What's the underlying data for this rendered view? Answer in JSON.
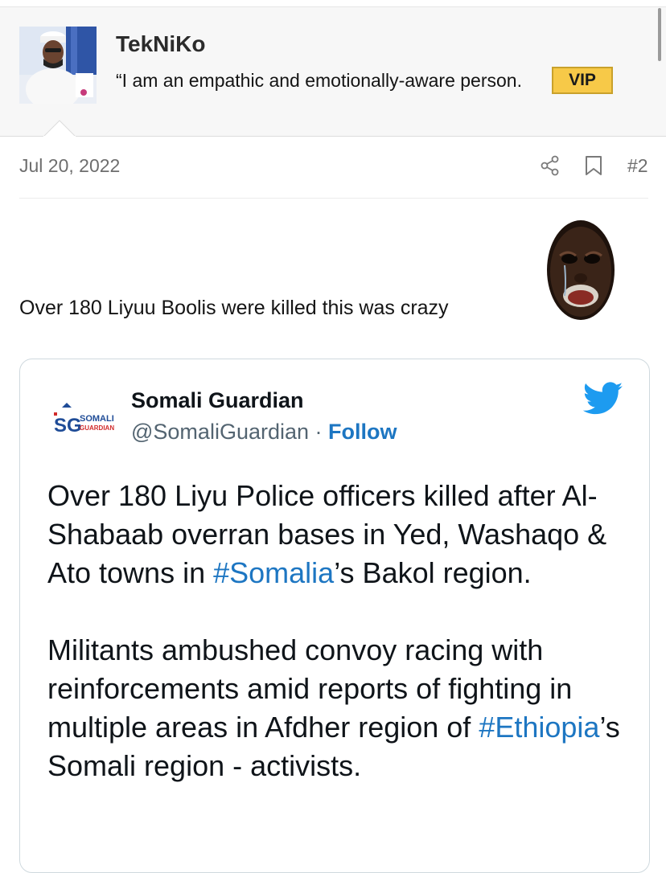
{
  "user": {
    "name": "TekNiKo",
    "title": "“I am an empathic and emotionally-aware person.",
    "badge": "VIP"
  },
  "post": {
    "date": "Jul 20, 2022",
    "number": "#2",
    "text": "Over 180 Liyuu Boolis were killed this was crazy",
    "icons": [
      "share-icon",
      "bookmark-icon",
      "crying-face-emoji"
    ]
  },
  "tweet": {
    "logo_text_top": "SOMALI",
    "logo_text_bottom": "GUARDIAN",
    "logo_letters": "SG",
    "name": "Somali Guardian",
    "handle": "@SomaliGuardian",
    "separator": " · ",
    "follow": "Follow",
    "p1_a": "Over 180 Liyu Police officers killed after Al-Shabaab overran bases in Yed, Washaqo & Ato towns in ",
    "p1_tag": "#Somalia",
    "p1_b": "’s Bakol region.",
    "p2_a": "Militants ambushed convoy racing with reinforcements amid reports of fighting in multiple areas in Afdher region of ",
    "p2_tag": "#Ethiopia",
    "p2_b": "’s Somali region - activists.",
    "icon": "twitter-bird-icon"
  },
  "colors": {
    "badge_bg": "#f7c948",
    "link": "#1d76c2",
    "twitter_blue": "#1d9bf0"
  }
}
